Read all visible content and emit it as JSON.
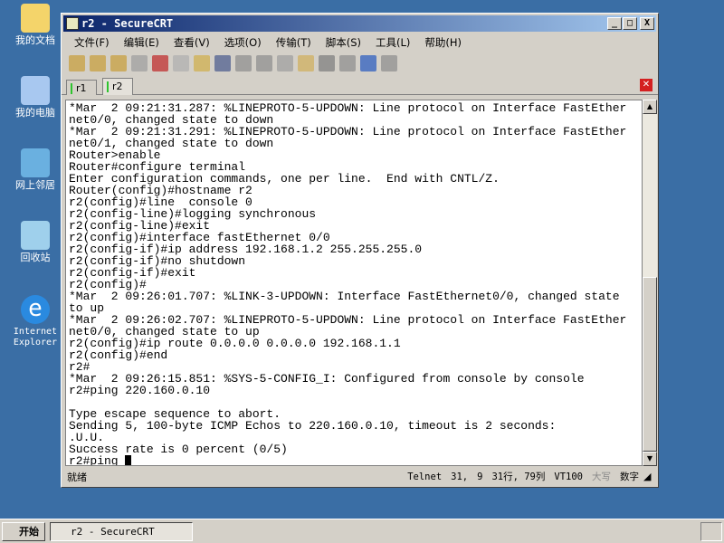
{
  "desktop": {
    "icons": [
      "我的文档",
      "我的电脑",
      "网上邻居",
      "回收站",
      "Internet Explorer"
    ]
  },
  "window": {
    "title": "r2 - SecureCRT",
    "minimize": "_",
    "maximize": "□",
    "close": "X"
  },
  "menu": [
    "文件(F)",
    "编辑(E)",
    "查看(V)",
    "选项(O)",
    "传输(T)",
    "脚本(S)",
    "工具(L)",
    "帮助(H)"
  ],
  "toolbar": [
    "connect-icon",
    "quick-connect-icon",
    "connect-tab-icon",
    "reconnect-icon",
    "disconnect-icon",
    "copy-icon",
    "paste-icon",
    "find-icon",
    "print-icon",
    "print-selection-icon",
    "print-setup-icon",
    "session-options-icon",
    "keymap-icon",
    "key-icon",
    "help-icon",
    "window-icon"
  ],
  "tabs": [
    {
      "label": "r1"
    },
    {
      "label": "r2",
      "active": true
    }
  ],
  "terminal": {
    "text": "*Mar  2 09:21:31.287: %LINEPROTO-5-UPDOWN: Line protocol on Interface FastEther\nnet0/0, changed state to down\n*Mar  2 09:21:31.291: %LINEPROTO-5-UPDOWN: Line protocol on Interface FastEther\nnet0/1, changed state to down\nRouter>enable\nRouter#configure terminal\nEnter configuration commands, one per line.  End with CNTL/Z.\nRouter(config)#hostname r2\nr2(config)#line  console 0\nr2(config-line)#logging synchronous\nr2(config-line)#exit\nr2(config)#interface fastEthernet 0/0\nr2(config-if)#ip address 192.168.1.2 255.255.255.0\nr2(config-if)#no shutdown\nr2(config-if)#exit\nr2(config)#\n*Mar  2 09:26:01.707: %LINK-3-UPDOWN: Interface FastEthernet0/0, changed state\nto up\n*Mar  2 09:26:02.707: %LINEPROTO-5-UPDOWN: Line protocol on Interface FastEther\nnet0/0, changed state to up\nr2(config)#ip route 0.0.0.0 0.0.0.0 192.168.1.1\nr2(config)#end\nr2#\n*Mar  2 09:26:15.851: %SYS-5-CONFIG_I: Configured from console by console\nr2#ping 220.160.0.10\n\nType escape sequence to abort.\nSending 5, 100-byte ICMP Echos to 220.160.0.10, timeout is 2 seconds:\n.U.U.\nSuccess rate is 0 percent (0/5)\n",
    "prompt": "r2#ping "
  },
  "status": {
    "ready": "就绪",
    "protocol": "Telnet",
    "row": "31,",
    "col": "9",
    "size": "31行, 79列",
    "emulation": "VT100",
    "caps": "大写",
    "num": "数字"
  },
  "taskbar": {
    "start": "开始",
    "task": "r2 - SecureCRT"
  }
}
